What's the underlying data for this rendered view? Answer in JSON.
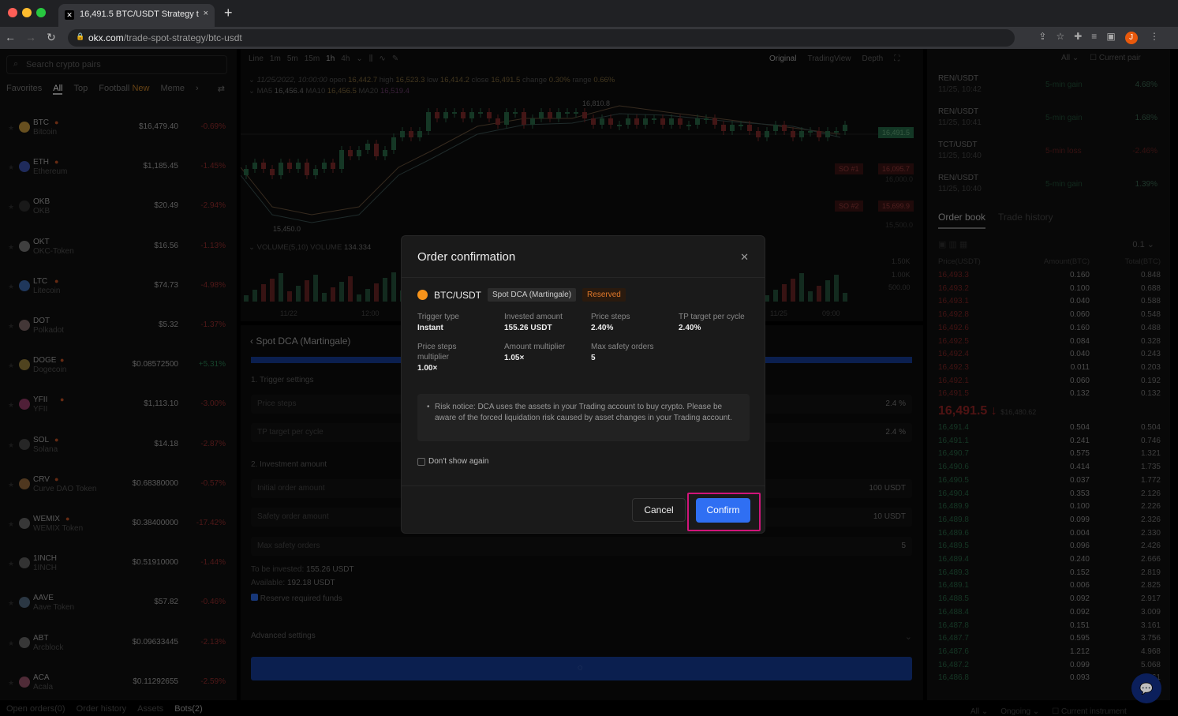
{
  "browser": {
    "tab_title": "16,491.5 BTC/USDT Strategy t",
    "url_host": "okx.com",
    "url_path": "/trade-spot-strategy/btc-usdt",
    "avatar": "J"
  },
  "left": {
    "search_placeholder": "Search crypto pairs",
    "filters": [
      "Favorites",
      "All",
      "Top",
      "Football",
      "Meme"
    ],
    "new_badge": "New",
    "coins": [
      {
        "sym": "BTC",
        "name": "Bitcoin",
        "price": "$16,479.40",
        "change": "-0.69%",
        "hot": true,
        "color": "#8a6a2a"
      },
      {
        "sym": "ETH",
        "name": "Ethereum",
        "price": "$1,185.45",
        "change": "-1.45%",
        "hot": true,
        "color": "#2a3a7a"
      },
      {
        "sym": "OKB",
        "name": "OKB",
        "price": "$20.49",
        "change": "-2.94%",
        "hot": false,
        "color": "#222"
      },
      {
        "sym": "OKT",
        "name": "OKC-Token",
        "price": "$16.56",
        "change": "-1.13%",
        "hot": false,
        "color": "#555"
      },
      {
        "sym": "LTC",
        "name": "Litecoin",
        "price": "$74.73",
        "change": "-4.98%",
        "hot": true,
        "color": "#2a4a7a"
      },
      {
        "sym": "DOT",
        "name": "Polkadot",
        "price": "$5.32",
        "change": "-1.37%",
        "hot": false,
        "color": "#5a4a4a"
      },
      {
        "sym": "DOGE",
        "name": "Dogecoin",
        "price": "$0.08572500",
        "change": "+5.31%",
        "hot": true,
        "color": "#6a5a2a"
      },
      {
        "sym": "YFII",
        "name": "YFII",
        "price": "$1,113.10",
        "change": "-3.00%",
        "hot": true,
        "color": "#6a2a4a"
      },
      {
        "sym": "SOL",
        "name": "Solana",
        "price": "$14.18",
        "change": "-2.87%",
        "hot": true,
        "color": "#333"
      },
      {
        "sym": "CRV",
        "name": "Curve DAO Token",
        "price": "$0.68380000",
        "change": "-0.57%",
        "hot": true,
        "color": "#6a4a2a"
      },
      {
        "sym": "WEMIX",
        "name": "WEMIX Token",
        "price": "$0.38400000",
        "change": "-17.42%",
        "hot": true,
        "color": "#4a4a4a"
      },
      {
        "sym": "1INCH",
        "name": "1INCH",
        "price": "$0.51910000",
        "change": "-1.44%",
        "hot": false,
        "color": "#444"
      },
      {
        "sym": "AAVE",
        "name": "Aave Token",
        "price": "$57.82",
        "change": "-0.46%",
        "hot": false,
        "color": "#3a4a5a"
      },
      {
        "sym": "ABT",
        "name": "Arcblock",
        "price": "$0.09633445",
        "change": "-2.13%",
        "hot": false,
        "color": "#4a4a4a"
      },
      {
        "sym": "ACA",
        "name": "Acala",
        "price": "$0.11292655",
        "change": "-2.59%",
        "hot": false,
        "color": "#6a3a4a"
      }
    ]
  },
  "bottom_tabs": [
    "Open orders(0)",
    "Order history",
    "Assets",
    "Bots(2)"
  ],
  "chart": {
    "timeframes": [
      "Line",
      "1m",
      "5m",
      "15m",
      "1h",
      "4h"
    ],
    "views": [
      "Original",
      "TradingView",
      "Depth"
    ],
    "ohlc": {
      "date": "11/25/2022, 10:00:00",
      "open": "16,442.7",
      "high": "16,523.3",
      "low": "16,414.2",
      "close": "16,491.5",
      "change": "0.30%",
      "range": "0.66%"
    },
    "ma": {
      "ma5": "16,456.4",
      "ma10": "16,456.5",
      "ma20": "16,519.4"
    },
    "high_label": "16,810.8",
    "low_label": "15,450.0",
    "last_price": "16,491.5",
    "so1": "SO #1",
    "so1_price": "16,095.7",
    "so2": "SO #2",
    "so2_price": "15,699.9",
    "volume_label": "VOLUME(5,10)",
    "volume_value": "134.334",
    "vol_ticks": [
      "1.50K",
      "1.00K",
      "500.00"
    ],
    "x_ticks": [
      "11/22",
      "12:00",
      "11/25",
      "09:00"
    ],
    "y_ticks": [
      "16,000.0",
      "15,500.0"
    ]
  },
  "form": {
    "title": "Spot DCA (Martingale)",
    "sec1": "1. Trigger settings",
    "price_steps": "Price steps",
    "price_steps_val": "2.4  %",
    "tp": "TP target per cycle",
    "tp_val": "2.4  %",
    "sec2": "2. Investment amount",
    "initial": "Initial order amount",
    "initial_val": "100  USDT",
    "safety": "Safety order amount",
    "safety_val": "10  USDT",
    "max": "Max safety orders",
    "max_val": "5",
    "to_invest_label": "To be invested:",
    "to_invest": "155.26 USDT",
    "available_label": "Available:",
    "available": "192.18 USDT",
    "reserve": "Reserve required funds",
    "advanced": "Advanced settings"
  },
  "right": {
    "filter": "All",
    "current_pair": "Current pair",
    "alerts": [
      {
        "pair": "REN/USDT",
        "time": "11/25, 10:42",
        "kind": "5-min gain",
        "val": "4.68%",
        "loss": false
      },
      {
        "pair": "REN/USDT",
        "time": "11/25, 10:41",
        "kind": "5-min gain",
        "val": "1.68%",
        "loss": false
      },
      {
        "pair": "TCT/USDT",
        "time": "11/25, 10:40",
        "kind": "5-min loss",
        "val": "-2.46%",
        "loss": true
      },
      {
        "pair": "REN/USDT",
        "time": "11/25, 10:40",
        "kind": "5-min gain",
        "val": "1.39%",
        "loss": false
      }
    ],
    "tabs": [
      "Order book",
      "Trade history"
    ],
    "precision": "0.1",
    "headers": [
      "Price(USDT)",
      "Amount(BTC)",
      "Total(BTC)"
    ],
    "asks": [
      [
        "16,493.3",
        "0.160",
        "0.848"
      ],
      [
        "16,493.2",
        "0.100",
        "0.688"
      ],
      [
        "16,493.1",
        "0.040",
        "0.588"
      ],
      [
        "16,492.8",
        "0.060",
        "0.548"
      ],
      [
        "16,492.6",
        "0.160",
        "0.488"
      ],
      [
        "16,492.5",
        "0.084",
        "0.328"
      ],
      [
        "16,492.4",
        "0.040",
        "0.243"
      ],
      [
        "16,492.3",
        "0.011",
        "0.203"
      ],
      [
        "16,492.1",
        "0.060",
        "0.192"
      ],
      [
        "16,491.5",
        "0.132",
        "0.132"
      ]
    ],
    "mid_price": "16,491.5 ↓",
    "mid_usd": "$16,480.62",
    "bids": [
      [
        "16,491.4",
        "0.504",
        "0.504"
      ],
      [
        "16,491.1",
        "0.241",
        "0.746"
      ],
      [
        "16,490.7",
        "0.575",
        "1.321"
      ],
      [
        "16,490.6",
        "0.414",
        "1.735"
      ],
      [
        "16,490.5",
        "0.037",
        "1.772"
      ],
      [
        "16,490.4",
        "0.353",
        "2.126"
      ],
      [
        "16,489.9",
        "0.100",
        "2.226"
      ],
      [
        "16,489.8",
        "0.099",
        "2.326"
      ],
      [
        "16,489.6",
        "0.004",
        "2.330"
      ],
      [
        "16,489.5",
        "0.096",
        "2.426"
      ],
      [
        "16,489.4",
        "0.240",
        "2.666"
      ],
      [
        "16,489.3",
        "0.152",
        "2.819"
      ],
      [
        "16,489.1",
        "0.006",
        "2.825"
      ],
      [
        "16,488.5",
        "0.092",
        "2.917"
      ],
      [
        "16,488.4",
        "0.092",
        "3.009"
      ],
      [
        "16,487.8",
        "0.151",
        "3.161"
      ],
      [
        "16,487.7",
        "0.595",
        "3.756"
      ],
      [
        "16,487.6",
        "1.212",
        "4.968"
      ],
      [
        "16,487.2",
        "0.099",
        "5.068"
      ],
      [
        "16,486.8",
        "0.093",
        "5.161"
      ]
    ],
    "bottom": [
      "All ⌄",
      "Ongoing ⌄",
      "Current instrument"
    ]
  },
  "modal": {
    "title": "Order confirmation",
    "pair": "BTC/USDT",
    "strategy_tag": "Spot DCA (Martingale)",
    "reserved_tag": "Reserved",
    "fields": [
      {
        "label": "Trigger type",
        "value": "Instant"
      },
      {
        "label": "Invested amount",
        "value": "155.26 USDT"
      },
      {
        "label": "Price steps",
        "value": "2.40%"
      },
      {
        "label": "TP target per cycle",
        "value": "2.40%"
      },
      {
        "label": "Price steps multiplier",
        "value": "1.00×"
      },
      {
        "label": "Amount multiplier",
        "value": "1.05×"
      },
      {
        "label": "Max safety orders",
        "value": "5"
      }
    ],
    "notice": "Risk notice: DCA uses the assets in your Trading account to buy crypto. Please be aware of the forced liquidation risk caused by asset changes in your Trading account.",
    "dont_show": "Don't show again",
    "cancel": "Cancel",
    "confirm": "Confirm"
  },
  "colors": {
    "accent": "#2f6ff3",
    "highlight": "#d0157a",
    "reserved": "#e0782a",
    "ask": "#6a1a1a",
    "bid": "#1d4a32"
  }
}
